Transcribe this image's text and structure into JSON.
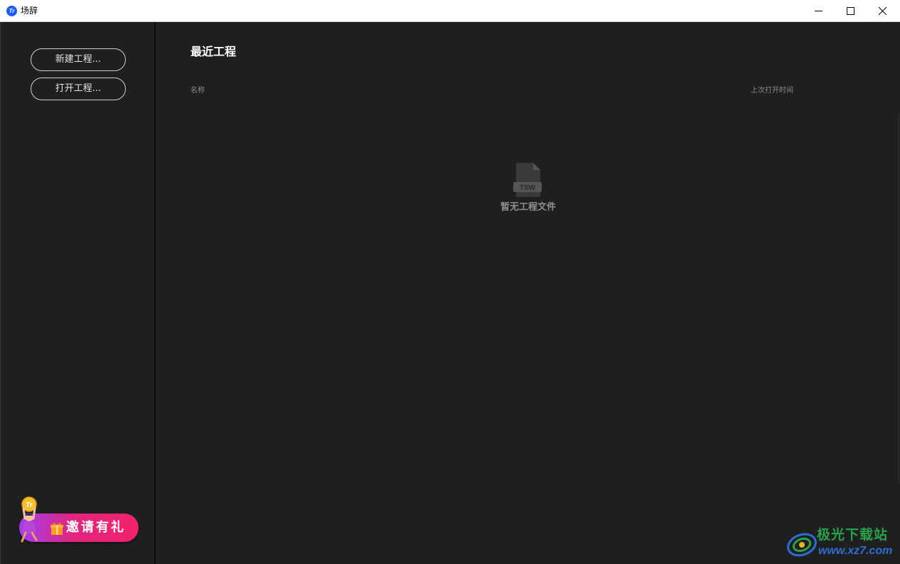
{
  "window": {
    "title": "场辞",
    "icon_label": "Tr"
  },
  "sidebar": {
    "new_project_label": "新建工程...",
    "open_project_label": "打开工程...",
    "invite_label": "邀请有礼"
  },
  "main": {
    "title": "最近工程",
    "columns": {
      "name": "名称",
      "last_opened": "上次打开时间"
    },
    "empty_icon_label": "TSW",
    "empty_text": "暂无工程文件"
  },
  "watermark": {
    "name": "极光下载站",
    "url": "www.xz7.com"
  },
  "colors": {
    "background": "#1f1f1f",
    "titlebar": "#ffffff",
    "accent": "#1a5cff",
    "invite_start": "#a23cf2",
    "invite_end": "#f0226a"
  }
}
